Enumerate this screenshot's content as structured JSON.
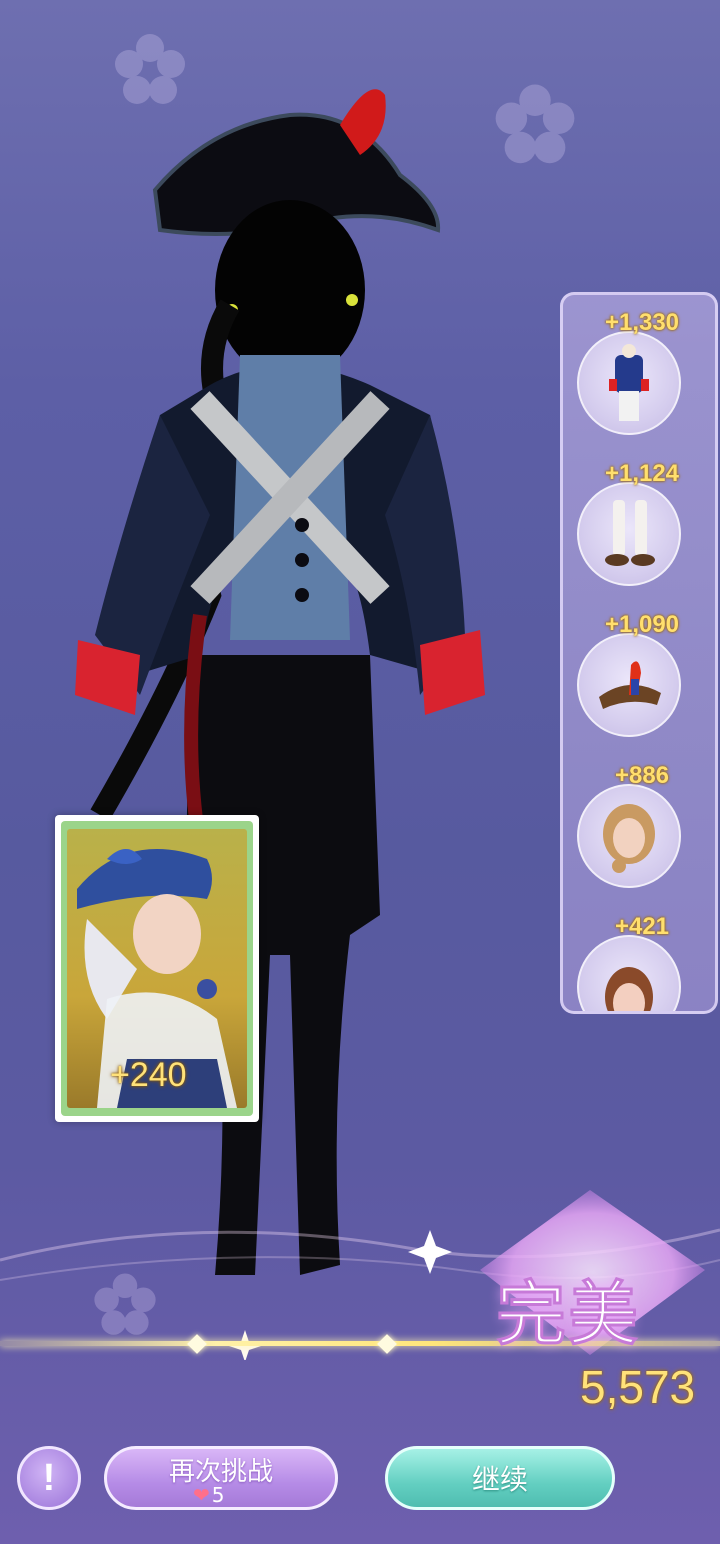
{
  "items": [
    {
      "score": "+1,330",
      "icon": "outfit-icon"
    },
    {
      "score": "+1,124",
      "icon": "boots-icon"
    },
    {
      "score": "+1,090",
      "icon": "hat-icon"
    },
    {
      "score": "+886",
      "icon": "hair-icon"
    },
    {
      "score": "+421",
      "icon": "face-icon"
    }
  ],
  "card": {
    "bonus": "+240"
  },
  "rating": {
    "label": "完美",
    "total": "5,573"
  },
  "buttons": {
    "info_label": "!",
    "retry_label": "再次挑战",
    "retry_cost": "5",
    "continue_label": "继续"
  },
  "colors": {
    "score_gold": "#ffe27a",
    "retry_purple": "#b58be6",
    "continue_teal": "#63cfc1"
  }
}
